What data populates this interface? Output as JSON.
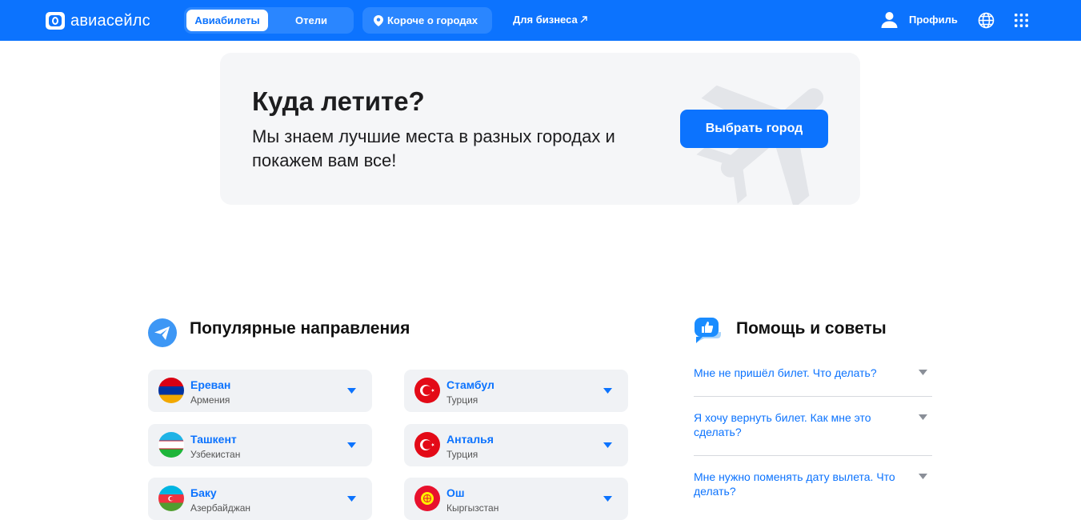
{
  "header": {
    "logo_text": "авиасейлс",
    "tabs": [
      {
        "label": "Авиабилеты",
        "active": true
      },
      {
        "label": "Отели",
        "active": false
      }
    ],
    "cities_label": "Короче о городах",
    "business_label": "Для бизнеса",
    "profile_label": "Профиль"
  },
  "hero": {
    "title": "Куда летите?",
    "subtitle": "Мы знаем лучшие места в разных городах и покажем вам все!",
    "button_label": "Выбрать город"
  },
  "popular": {
    "title": "Популярные направления",
    "destinations": [
      {
        "city": "Ереван",
        "country": "Армения",
        "flag": "armenia-flag-icon"
      },
      {
        "city": "Стамбул",
        "country": "Турция",
        "flag": "turkey-flag-icon"
      },
      {
        "city": "Ташкент",
        "country": "Узбекистан",
        "flag": "uzbekistan-flag-icon"
      },
      {
        "city": "Анталья",
        "country": "Турция",
        "flag": "turkey-flag-icon"
      },
      {
        "city": "Баку",
        "country": "Азербайджан",
        "flag": "azerbaijan-flag-icon"
      },
      {
        "city": "Ош",
        "country": "Кыргызстан",
        "flag": "kyrgyzstan-flag-icon"
      }
    ]
  },
  "help": {
    "title": "Помощь и советы",
    "questions": [
      "Мне не пришёл билет. Что делать?",
      "Я хочу вернуть билет. Как мне это сделать?",
      "Мне нужно поменять дату вылета. Что делать?"
    ]
  },
  "colors": {
    "brand": "#0c73fe",
    "card_bg": "#f0f2f5",
    "hero_bg": "#f5f6f8"
  }
}
